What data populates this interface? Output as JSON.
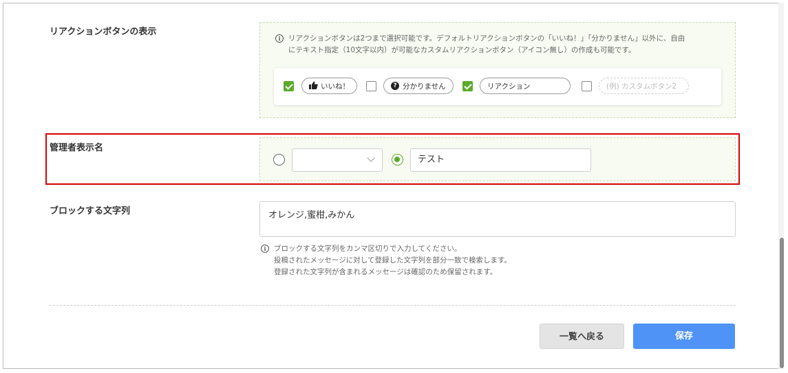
{
  "reaction_section": {
    "label": "リアクションボタンの表示",
    "info_line1": "リアクションボタンは2つまで選択可能です。デフォルトリアクションボタンの「いいね！」「分かりません」以外に、自由",
    "info_line2": "にテキスト指定（10文字以内）が可能なカスタムリアクションボタン（アイコン無し）の作成も可能です。",
    "buttons": [
      {
        "label": "いいね！",
        "checked": true,
        "icon": "thumbs-up-icon"
      },
      {
        "label": "分かりません",
        "checked": false,
        "icon": "question-circle-icon"
      },
      {
        "value": "リアクション",
        "checked": true
      },
      {
        "placeholder": "(例) カスタムボタン2",
        "checked": false
      }
    ]
  },
  "admin_name_section": {
    "label": "管理者表示名",
    "select_value": "",
    "text_value": "テスト",
    "selected_option": "text"
  },
  "block_section": {
    "label": "ブロックする文字列",
    "value": "オレンジ,蜜柑,みかん",
    "help_line1": "ブロックする文字列をカンマ区切りで入力してください。",
    "help_line2": "投稿されたメッセージに対して登録した文字列を部分一致で検索します。",
    "help_line3": "登録された文字列が含まれるメッセージは確認のため保留されます。"
  },
  "actions": {
    "back_label": "一覧へ戻る",
    "save_label": "保存"
  },
  "colors": {
    "accent_green": "#5aab2a",
    "save_blue": "#4e93f5",
    "highlight_red": "#d40000"
  }
}
